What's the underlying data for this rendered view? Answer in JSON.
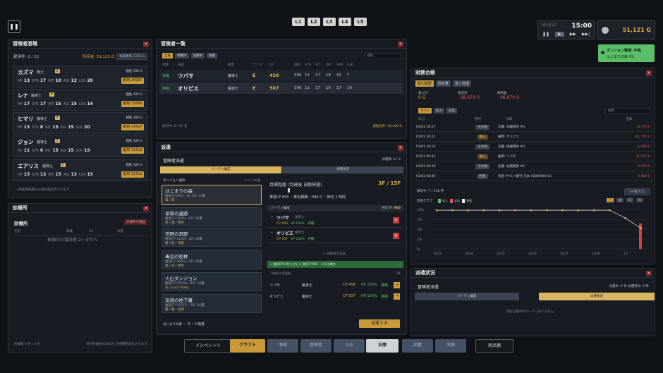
{
  "pause_icon": "pause-icon",
  "levels": [
    "L1",
    "L2",
    "L3",
    "L4",
    "L5"
  ],
  "clock": {
    "date": "1年1月1日",
    "time": "15:00"
  },
  "money": "51,121 G",
  "alert": {
    "title": "ダンジョン警報: 中程",
    "sub": "はじまりの森 0%"
  },
  "guild": {
    "title": "冒険者酒場",
    "slots": "雇用枠: 2 / 12",
    "funds": "所持金: 51,121 G",
    "refresh": "候補更新 1220 G",
    "footer": "一時雇用候補のみ各候補表示されます",
    "cards": [
      {
        "name": "カズマ",
        "job": "戦士",
        "rank": "E",
        "fee": "週給 300 G",
        "hp": "13",
        "str": "17",
        "int": "10",
        "agi": "12",
        "lck": "20",
        "price": "26997 G",
        "hire": "雇用"
      },
      {
        "name": "レナ",
        "job": "魔導士",
        "rank": "E",
        "fee": "週給 300 G",
        "hp": "17",
        "str": "17",
        "int": "15",
        "agi": "15",
        "lck": "14",
        "price": "33666 G",
        "hire": "雇用"
      },
      {
        "name": "ヒマリ",
        "job": "魔導士",
        "rank": "E",
        "fee": "週給 300 G",
        "hp": "13",
        "str": "8",
        "int": "15",
        "agi": "15",
        "lck": "20",
        "price": "34307 G",
        "hire": "雇用"
      },
      {
        "name": "ジョン",
        "job": "魔導士",
        "rank": "E",
        "fee": "週給 300 G",
        "hp": "11",
        "str": "6",
        "int": "15",
        "agi": "15",
        "lck": "19",
        "price": "31512 G",
        "hire": "雇用"
      },
      {
        "name": "エアリス",
        "job": "魔導士",
        "rank": "E",
        "fee": "週給 300 G",
        "hp": "15",
        "str": "13",
        "int": "15",
        "agi": "13",
        "lck": "15",
        "price": "31511 G",
        "hire": "雇用"
      }
    ]
  },
  "clinic": {
    "title": "診療所",
    "sub": "診療所",
    "btn": "診療所を開設",
    "cols": [
      "名前",
      "職業",
      "HP",
      "状態"
    ],
    "empty": "負傷中の冒険者はいません",
    "footer_l": "負傷者 0 名 / 0 名",
    "footer_r": "現在負傷者のみ表示 治療費用表示されます"
  },
  "roster": {
    "title": "冒険者一覧",
    "tabs": [
      "全員",
      "待機中",
      "派遣中",
      "負傷"
    ],
    "search": "検索...",
    "cols": [
      "状態",
      "名前",
      "職業",
      "ランク",
      "CP",
      "週給",
      "STR",
      "VIT",
      "INT",
      "SPD",
      "LUK"
    ],
    "rows": [
      {
        "st": "待機",
        "name": "ツバサ",
        "job": "魔導士",
        "rank": "E",
        "cp": "458",
        "fee": "300",
        "str": "11",
        "vit": "17",
        "int": "16",
        "spd": "15",
        "luk": "7"
      },
      {
        "st": "待機",
        "name": "オリビエ",
        "job": "魔導士",
        "rank": "E",
        "cp": "507",
        "fee": "300",
        "str": "11",
        "vit": "17",
        "int": "16",
        "spd": "17",
        "luk": "16"
      }
    ],
    "footer_l": "雇用中: 2 / 12 名",
    "footer_r": "週給合計: 10,400 G"
  },
  "dispatch": {
    "title": "派遣",
    "sub": "冒険者派遣",
    "slots": "派遣枠: 2 / 2",
    "tabs": [
      "パーティ編成",
      "派遣状況"
    ],
    "dsel": "ダンジョン選択",
    "dsel_r": "スペース切替",
    "dungeons": [
      {
        "t": "はじまりの森",
        "s": "推奨CP 815+  1F  15F  15層",
        "g": "森 / 草"
      },
      {
        "t": "草原の遺跡",
        "s": "推奨CP 1185+  25F  20層",
        "g": "草 / 遺 / 平原"
      },
      {
        "t": "荒野の洞窟",
        "s": "推奨CP 2160+  30F  24層",
        "g": "岩 / 暗 / 洞窟"
      },
      {
        "t": "毒沼の密林",
        "s": "推奨CP 4640+  35F  28層",
        "g": "毒 / 沼 / 密林"
      },
      {
        "t": "火山ダンジョン",
        "s": "推奨CP 16000+  40F  30層",
        "g": "炎 / 火山 / Ruby"
      },
      {
        "t": "深淵の地下墓",
        "s": "推奨CP 59375+  50F  42層",
        "g": "闇 / 墓 / 深淵"
      }
    ],
    "target_lbl": "目標階層 (到達後 自動帰還)",
    "target": "3F / 15F",
    "est": "推奨CP 890  ・推定報酬 ~490 G  ・推定 2 時間",
    "party_lbl": "パーティ編成",
    "party_cp": "合計CP: ",
    "party_cp_val": "965",
    "party": [
      {
        "name": "ツバサ",
        "job": "魔導士",
        "cp": "CP 458",
        "hp": "HP 100%",
        "st": "待機"
      },
      {
        "name": "オリビエ",
        "job": "魔導士",
        "cp": "CP 507",
        "hp": "HP 100%",
        "st": "待機"
      }
    ],
    "add": "+ 冒険者を追加",
    "ok": "推奨CP 4 時 に対して 現在CP 965 ・十分な戦力",
    "wait_lbl": "待機中の冒険者",
    "wait_r": "5件",
    "wait": [
      {
        "name": "ツバサ",
        "job": "魔導士",
        "cp": "CP 458",
        "hp": "HP 100%",
        "st": "待機"
      },
      {
        "name": "オリビエ",
        "job": "魔導士",
        "cp": "CP 507",
        "hp": "HP 100%",
        "st": "待機"
      }
    ],
    "footer": "はじまりの森 — 3F / 15階層",
    "go": "派遣する"
  },
  "ledger": {
    "title": "財務台帳",
    "tabs": [
      "取引履歴",
      "固定費",
      "借入管理"
    ],
    "sums": [
      {
        "l": "収入計",
        "v": "0 G"
      },
      {
        "l": "支出計",
        "v": "- 98,879 G"
      },
      {
        "l": "純利益",
        "v": "- 98,879 G"
      }
    ],
    "filters": [
      "すべて",
      "収入",
      "支出"
    ],
    "search": "検索...",
    "cols": [
      "日付",
      "種別",
      "詳細",
      "金額"
    ],
    "rows": [
      {
        "d": "01/01 10:27",
        "k": "その他",
        "inc": false,
        "x": "念書: 候補更新 #4",
        "v": "-8,775 G"
      },
      {
        "d": "01/01 10:22",
        "k": "収入",
        "inc": true,
        "x": "雇用: オリビエ",
        "v": "-41,755 G"
      },
      {
        "d": "01/01 10:14",
        "k": "その他",
        "inc": false,
        "x": "念書: 候補更新 #3",
        "v": "-6,300 G"
      },
      {
        "d": "01/01 09:32",
        "k": "収入",
        "inc": true,
        "x": "雇用: ツバサ",
        "v": "-31,512 G"
      },
      {
        "d": "01/01 09:18",
        "k": "その他",
        "inc": false,
        "x": "念書: 候補更新 #2",
        "v": "-3,923 G"
      },
      {
        "d": "01/01 08:00",
        "k": "利息",
        "inc": false,
        "x": "利息 (ギルド銀行 元本 10000000 G)",
        "v": "-9,464 G"
      }
    ],
    "count": "表示中: 7 / 118 件",
    "csv": "CSV書き出し",
    "graph_lbl": "収支グラフ",
    "legend": [
      "収入",
      "支出",
      "残高"
    ],
    "ranges": [
      "日",
      "週",
      "月",
      "年"
    ],
    "chart": {
      "y_ticks": [
        "100k",
        "75k",
        "50k",
        "25k",
        "0k"
      ],
      "x_ticks": [
        "12/23",
        "12/24",
        "12/25",
        "12/26",
        "12/27",
        "12/28",
        "1/1"
      ],
      "balance": [
        98,
        98,
        98,
        98,
        98,
        98,
        98,
        98,
        98,
        98,
        98,
        98,
        78,
        52
      ],
      "expense": [
        0,
        0,
        0,
        0,
        0,
        0,
        0,
        0,
        0,
        0,
        0,
        0,
        0,
        40
      ]
    }
  },
  "dstatus": {
    "title": "派遣状況",
    "sub": "冒険者派遣",
    "info": "派遣中: 2 件  派遣済み: 0 件",
    "tabs": [
      "パーティ編成",
      "派遣状況"
    ],
    "empty": "現在派遣中のパーティはいません"
  },
  "bottom": {
    "inv": "インベントリ",
    "nav": [
      "クラフト",
      "酒場",
      "冒険者",
      "派遣",
      "治療",
      "図鑑",
      "実績"
    ],
    "shop": "商品棚"
  }
}
